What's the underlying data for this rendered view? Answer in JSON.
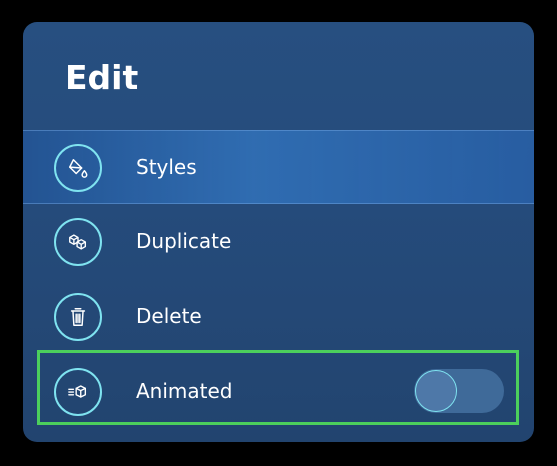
{
  "menu": {
    "title": "Edit",
    "items": [
      {
        "label": "Styles",
        "icon": "paint-bucket-icon"
      },
      {
        "label": "Duplicate",
        "icon": "duplicate-cubes-icon"
      },
      {
        "label": "Delete",
        "icon": "trash-icon"
      },
      {
        "label": "Animated",
        "icon": "animated-cube-icon",
        "toggle_on": false
      }
    ]
  },
  "colors": {
    "panel": "#274f80",
    "accent": "#7fe3f0",
    "highlight": "#306eb4",
    "selection_outline": "#4ccf5c"
  }
}
